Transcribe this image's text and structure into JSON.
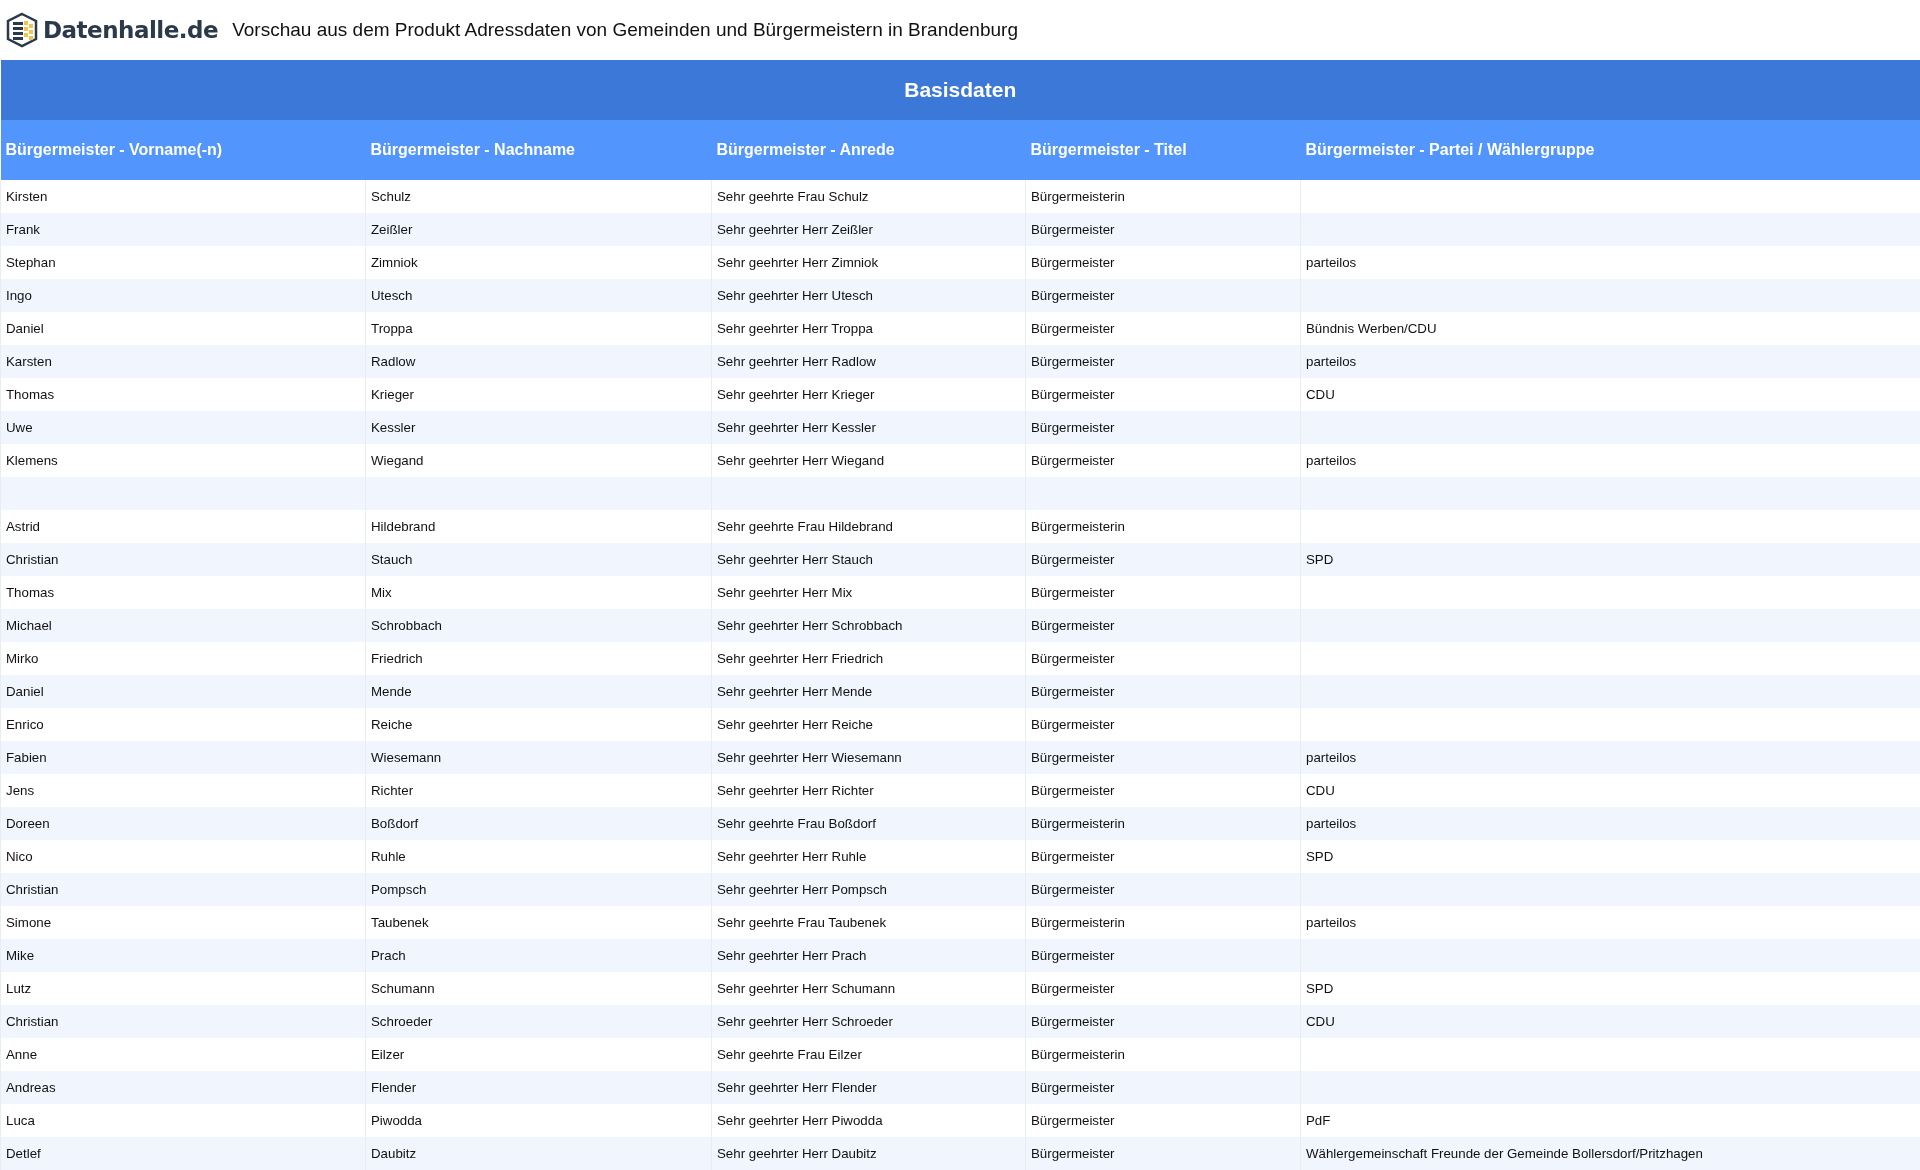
{
  "header": {
    "logo_text": "Datenhalle.de",
    "title": "Vorschau aus dem Produkt Adressdaten von Gemeinden und Bürgermeistern in Brandenburg"
  },
  "table": {
    "group_title": "Basisdaten",
    "columns": [
      "Bürgermeister - Vorname(-n)",
      "Bürgermeister - Nachname",
      "Bürgermeister - Anrede",
      "Bürgermeister - Titel",
      "Bürgermeister - Partei / Wählergruppe"
    ],
    "rows": [
      {
        "vorname": "Kirsten",
        "nachname": "Schulz",
        "anrede": "Sehr geehrte Frau Schulz",
        "titel": "Bürgermeisterin"
      },
      {
        "vorname": "Frank",
        "nachname": "Zeißler",
        "anrede": "Sehr geehrter Herr Zeißler",
        "titel": "Bürgermeister"
      },
      {
        "vorname": "Stephan",
        "nachname": "Zimniok",
        "anrede": "Sehr geehrter Herr Zimniok",
        "titel": "Bürgermeister",
        "partei": "parteilos"
      },
      {
        "vorname": "Ingo",
        "nachname": "Utesch",
        "anrede": "Sehr geehrter Herr Utesch",
        "titel": "Bürgermeister"
      },
      {
        "vorname": "Daniel",
        "nachname": "Troppa",
        "anrede": "Sehr geehrter Herr Troppa",
        "titel": "Bürgermeister",
        "partei": "Bündnis Werben/CDU"
      },
      {
        "vorname": "Karsten",
        "nachname": "Radlow",
        "anrede": "Sehr geehrter Herr Radlow",
        "titel": "Bürgermeister",
        "partei": "parteilos"
      },
      {
        "vorname": "Thomas",
        "nachname": "Krieger",
        "anrede": "Sehr geehrter Herr Krieger",
        "titel": "Bürgermeister",
        "partei": "CDU"
      },
      {
        "vorname": "Uwe",
        "nachname": "Kessler",
        "anrede": "Sehr geehrter Herr Kessler",
        "titel": "Bürgermeister"
      },
      {
        "vorname": "Klemens",
        "nachname": "Wiegand",
        "anrede": "Sehr geehrter Herr Wiegand",
        "titel": "Bürgermeister",
        "partei": "parteilos"
      },
      {},
      {
        "vorname": "Astrid",
        "nachname": "Hildebrand",
        "anrede": "Sehr geehrte Frau Hildebrand",
        "titel": "Bürgermeisterin"
      },
      {
        "vorname": "Christian",
        "nachname": "Stauch",
        "anrede": "Sehr geehrter Herr Stauch",
        "titel": "Bürgermeister",
        "partei": "SPD"
      },
      {
        "vorname": "Thomas",
        "nachname": "Mix",
        "anrede": "Sehr geehrter Herr Mix",
        "titel": "Bürgermeister"
      },
      {
        "vorname": "Michael",
        "nachname": "Schrobbach",
        "anrede": "Sehr geehrter Herr Schrobbach",
        "titel": "Bürgermeister"
      },
      {
        "vorname": "Mirko",
        "nachname": "Friedrich",
        "anrede": "Sehr geehrter Herr Friedrich",
        "titel": "Bürgermeister"
      },
      {
        "vorname": "Daniel",
        "nachname": "Mende",
        "anrede": "Sehr geehrter Herr Mende",
        "titel": "Bürgermeister"
      },
      {
        "vorname": "Enrico",
        "nachname": "Reiche",
        "anrede": "Sehr geehrter Herr Reiche",
        "titel": "Bürgermeister"
      },
      {
        "vorname": "Fabien",
        "nachname": "Wiesemann",
        "anrede": "Sehr geehrter Herr Wiesemann",
        "titel": "Bürgermeister",
        "partei": "parteilos"
      },
      {
        "vorname": "Jens",
        "nachname": "Richter",
        "anrede": "Sehr geehrter Herr Richter",
        "titel": "Bürgermeister",
        "partei": "CDU"
      },
      {
        "vorname": "Doreen",
        "nachname": "Boßdorf",
        "anrede": "Sehr geehrte Frau Boßdorf",
        "titel": "Bürgermeisterin",
        "partei": "parteilos"
      },
      {
        "vorname": "Nico",
        "nachname": "Ruhle",
        "anrede": "Sehr geehrter Herr Ruhle",
        "titel": "Bürgermeister",
        "partei": "SPD"
      },
      {
        "vorname": "Christian",
        "nachname": "Pompsch",
        "anrede": "Sehr geehrter Herr Pompsch",
        "titel": "Bürgermeister"
      },
      {
        "vorname": "Simone",
        "nachname": "Taubenek",
        "anrede": "Sehr geehrte Frau Taubenek",
        "titel": "Bürgermeisterin",
        "partei": "parteilos"
      },
      {
        "vorname": "Mike",
        "nachname": "Prach",
        "anrede": "Sehr geehrter Herr Prach",
        "titel": "Bürgermeister"
      },
      {
        "vorname": "Lutz",
        "nachname": "Schumann",
        "anrede": "Sehr geehrter Herr Schumann",
        "titel": "Bürgermeister",
        "partei": "SPD"
      },
      {
        "vorname": "Christian",
        "nachname": "Schroeder",
        "anrede": "Sehr geehrter Herr Schroeder",
        "titel": "Bürgermeister",
        "partei": "CDU"
      },
      {
        "vorname": "Anne",
        "nachname": "Eilzer",
        "anrede": "Sehr geehrte Frau Eilzer",
        "titel": "Bürgermeisterin"
      },
      {
        "vorname": "Andreas",
        "nachname": "Flender",
        "anrede": "Sehr geehrter Herr Flender",
        "titel": "Bürgermeister"
      },
      {
        "vorname": "Luca",
        "nachname": "Piwodda",
        "anrede": "Sehr geehrter Herr Piwodda",
        "titel": "Bürgermeister",
        "partei": "PdF"
      },
      {
        "vorname": "Detlef",
        "nachname": "Daubitz",
        "anrede": "Sehr geehrter Herr Daubitz",
        "titel": "Bürgermeister",
        "partei": "Wählergemeinschaft Freunde der Gemeinde Bollersdorf/Pritzhagen"
      }
    ]
  }
}
